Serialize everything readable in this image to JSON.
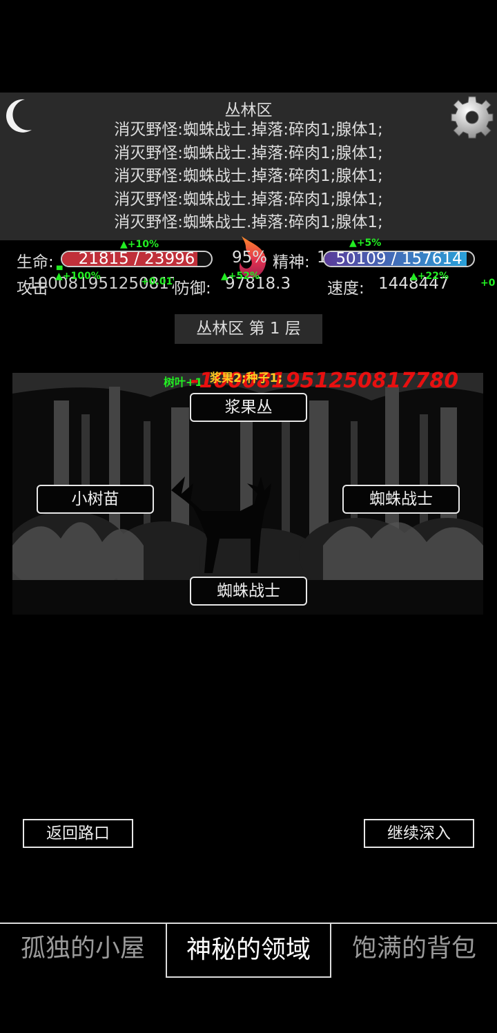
{
  "log": {
    "title": "丛林区",
    "lines": [
      "消灭野怪:蜘蛛战士.掉落:碎肉1;腺体1;",
      "消灭野怪:蜘蛛战士.掉落:碎肉1;腺体1;",
      "消灭野怪:蜘蛛战士.掉落:碎肉1;腺体1;",
      "消灭野怪:蜘蛛战士.掉落:碎肉1;腺体1;",
      "消灭野怪:蜘蛛战士.掉落:碎肉1;腺体1;"
    ]
  },
  "stats": {
    "life_label": "生命:",
    "life_text": "21815 / 23996",
    "life_fraction": 0.909,
    "life_buff": "+10%",
    "hunger_pct": "95%",
    "spirit_label": "精神:",
    "spirit_prefix": "1",
    "spirit_text": "50109 / 157614",
    "spirit_fraction": 0.953,
    "spirit_buff": "+5%",
    "attack_label": "攻击",
    "attack_value": "1000819512508177",
    "attack_buff": "+100%",
    "attack_buff2": "+0.01%",
    "defense_label": "防御:",
    "defense_value": "97818.3",
    "defense_buff": "+52%",
    "speed_label": "速度:",
    "speed_value": "1448447",
    "speed_buff": "+22%",
    "edge_buff": "+0"
  },
  "floor": {
    "label": "丛林区 第 1 层"
  },
  "map": {
    "top_button": "浆果丛",
    "left_button": "小树苗",
    "right_button": "蜘蛛战士",
    "bottom_button": "蜘蛛战士"
  },
  "popups": {
    "leaf": "树叶+1",
    "berry": "浆果2;种子1;",
    "damage": "-1000819512508177​80"
  },
  "actions": {
    "return": "返回路口",
    "continue": "继续深入"
  },
  "tabs": [
    {
      "label": "孤独的小屋"
    },
    {
      "label": "神秘的领域"
    },
    {
      "label": "饱满的背包"
    }
  ],
  "colors": {
    "life_bar": "#c0303a",
    "spirit_bar_start": "#5a3c9a",
    "spirit_bar_end": "#2aa0d8",
    "buff": "#22ee22",
    "damage": "#e81010",
    "berry_popup": "#ffcc22"
  }
}
